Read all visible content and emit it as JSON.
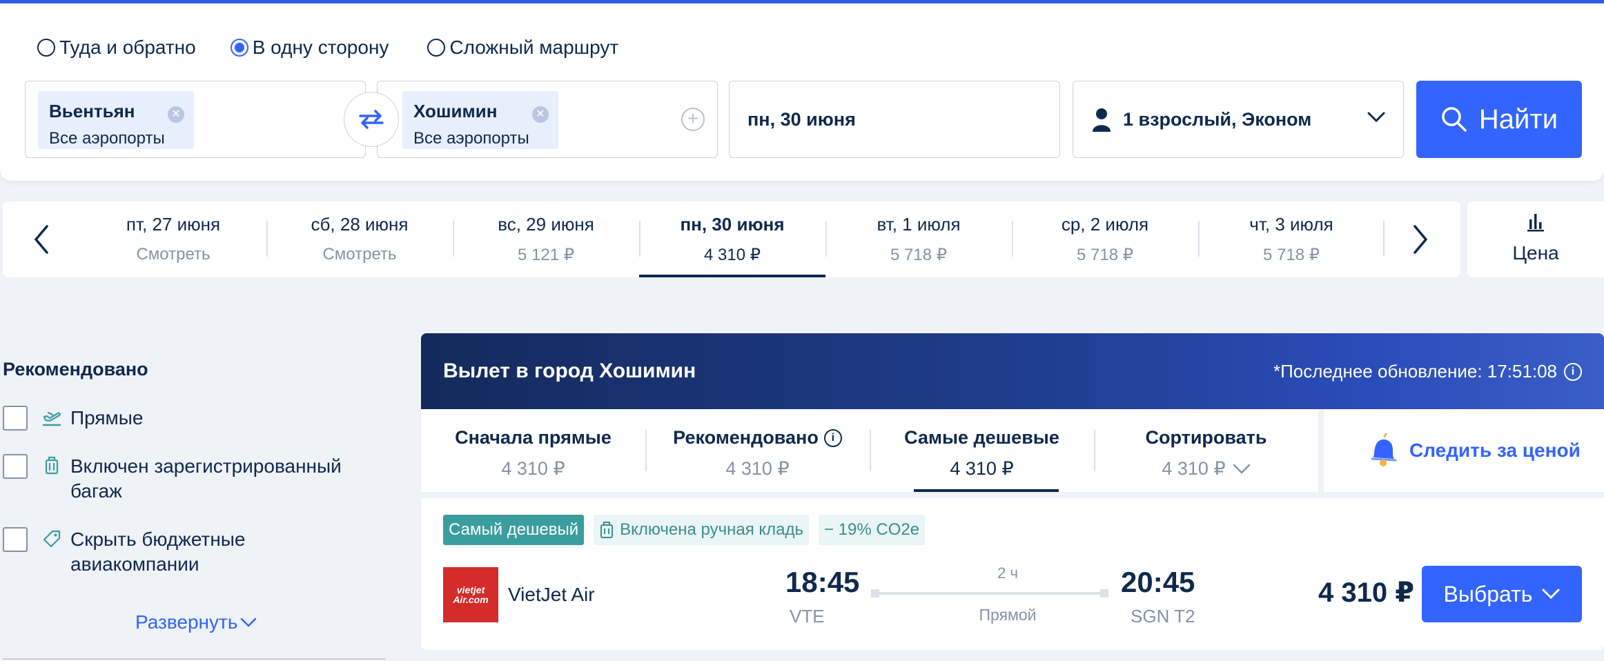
{
  "search": {
    "trip_types": [
      {
        "label": "Туда и обратно",
        "selected": false
      },
      {
        "label": "В одну сторону",
        "selected": true
      },
      {
        "label": "Сложный маршрут",
        "selected": false
      }
    ],
    "origin": {
      "city": "Вьентьян",
      "sub": "Все аэропорты"
    },
    "destination": {
      "city": "Хошимин",
      "sub": "Все аэропорты"
    },
    "date": "пн, 30 июня",
    "passengers": "1 взрослый, Эконом",
    "search_button": "Найти"
  },
  "date_strip": {
    "dates": [
      {
        "label": "пт, 27 июня",
        "price": "Смотреть",
        "active": false
      },
      {
        "label": "сб, 28 июня",
        "price": "Смотреть",
        "active": false
      },
      {
        "label": "вс, 29 июня",
        "price": "5 121 ₽",
        "active": false
      },
      {
        "label": "пн, 30 июня",
        "price": "4 310 ₽",
        "active": true
      },
      {
        "label": "вт, 1 июля",
        "price": "5 718 ₽",
        "active": false
      },
      {
        "label": "ср, 2 июля",
        "price": "5 718 ₽",
        "active": false
      },
      {
        "label": "чт, 3 июля",
        "price": "5 718 ₽",
        "active": false
      }
    ],
    "price_toggle": "Цена"
  },
  "filters": {
    "title": "Рекомендовано",
    "items": [
      {
        "label": "Прямые",
        "icon": "plane-takeoff-icon"
      },
      {
        "label": "Включен зарегистрированный багаж",
        "icon": "luggage-icon"
      },
      {
        "label": "Скрыть бюджетные авиакомпании",
        "icon": "tag-icon"
      }
    ],
    "expand": "Развернуть"
  },
  "results": {
    "banner_title": "Вылет в город Хошимин",
    "last_update": "*Последнее обновление: 17:51:08",
    "sort_tabs": [
      {
        "label": "Сначала прямые",
        "price": "4 310 ₽",
        "active": false
      },
      {
        "label": "Рекомендовано",
        "price": "4 310 ₽",
        "active": false
      },
      {
        "label": "Самые дешевые",
        "price": "4 310 ₽",
        "active": true
      },
      {
        "label": "Сортировать",
        "price": "4 310 ₽",
        "active": false
      }
    ],
    "watch_price": "Следить за ценой"
  },
  "flight": {
    "tags": [
      "Самый дешевый",
      "Включена ручная кладь",
      "− 19% CO2e"
    ],
    "airline": "VietJet Air",
    "logo_text": "vietjet Air.com",
    "dep_time": "18:45",
    "dep_code": "VTE",
    "duration": "2 ч",
    "stops": "Прямой",
    "arr_time": "20:45",
    "arr_code": "SGN T2",
    "price": "4 310 ₽",
    "select_button": "Выбрать"
  },
  "colors": {
    "accent": "#3264ff",
    "text": "#0f294d",
    "muted": "#8592a6",
    "tag_teal": "#3a9d9e"
  }
}
